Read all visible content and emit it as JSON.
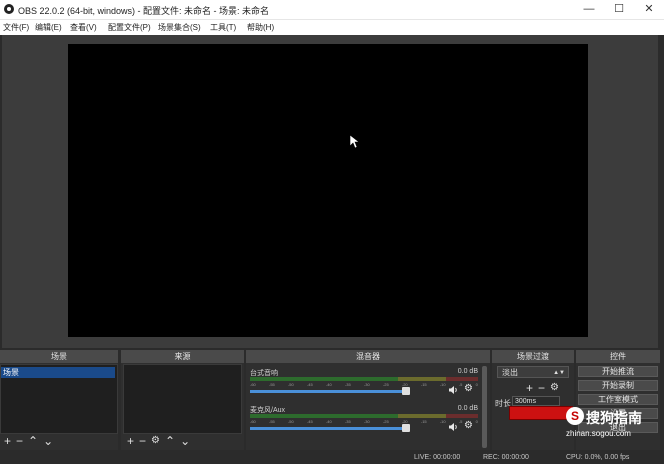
{
  "window": {
    "title": "OBS 22.0.2 (64-bit, windows) - 配置文件: 未命名 - 场景: 未命名",
    "minimize": "—",
    "maximize": "☐",
    "close": "✕"
  },
  "menu": [
    {
      "label": "文件(F)"
    },
    {
      "label": "编辑(E)"
    },
    {
      "label": "查看(V)"
    },
    {
      "label": "配置文件(P)"
    },
    {
      "label": "场景集合(S)"
    },
    {
      "label": "工具(T)"
    },
    {
      "label": "帮助(H)"
    }
  ],
  "docks": {
    "scenes": {
      "title": "场景",
      "items": [
        {
          "label": "场景"
        }
      ]
    },
    "sources": {
      "title": "来源"
    },
    "mixer": {
      "title": "混音器",
      "tracks": [
        {
          "name": "台式音响",
          "db": "0.0 dB",
          "volume": 0.82
        },
        {
          "name": "麦克风/Aux",
          "db": "0.0 dB",
          "volume": 0.82
        }
      ],
      "tick_labels": [
        "-60",
        "-55",
        "-50",
        "-45",
        "-40",
        "-35",
        "-30",
        "-25",
        "-20",
        "-15",
        "-10",
        "-5",
        "0"
      ]
    },
    "transitions": {
      "title": "场景过渡",
      "selected": "淡出",
      "duration_label": "时长",
      "duration_value": "300ms"
    },
    "controls": {
      "title": "控件",
      "buttons": [
        "开始推流",
        "开始录制",
        "工作室模式",
        "设置",
        "退出"
      ]
    }
  },
  "icons": {
    "add": "+",
    "remove": "−",
    "up": "⌃",
    "down": "⌄",
    "gear": "⚙",
    "speaker": "🔊"
  },
  "status": {
    "live": "LIVE: 00:00:00",
    "rec": "REC: 00:00:00",
    "cpu": "CPU: 0.0%, 0.00 fps"
  },
  "watermark": {
    "logo": "S",
    "text": "搜狗指南",
    "url": "zhinan.sogou.com"
  },
  "colors": {
    "accent": "#1a4a8a",
    "slider": "#4a90d9",
    "highlight_box": "#cc1111"
  }
}
